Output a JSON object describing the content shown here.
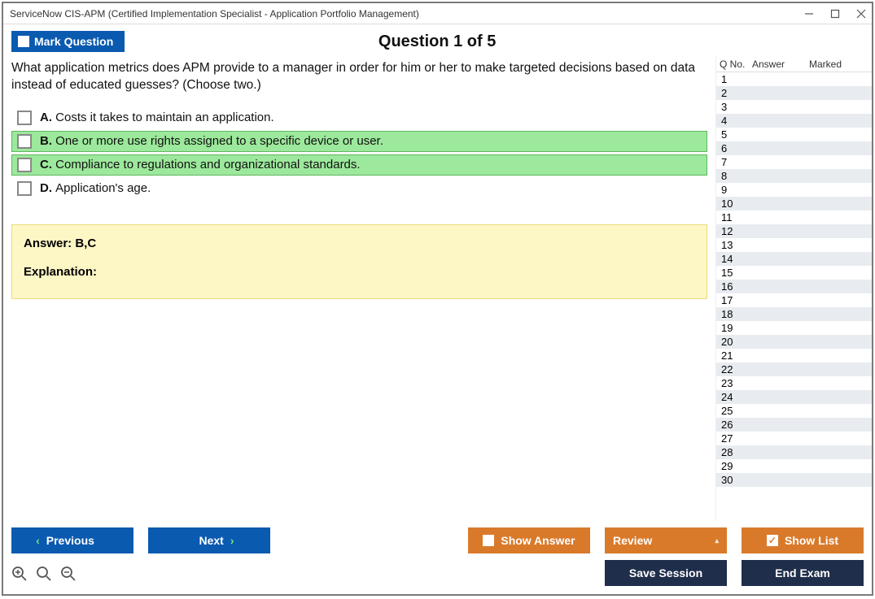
{
  "titlebar": "ServiceNow CIS-APM (Certified Implementation Specialist - Application Portfolio Management)",
  "header": {
    "mark_label": "Mark Question",
    "question_title": "Question 1 of 5"
  },
  "question": {
    "text": "What application metrics does APM provide to a manager in order for him or her to make targeted decisions based on data instead of educated guesses? (Choose two.)",
    "options": [
      {
        "letter": "A.",
        "text": "Costs it takes to maintain an application.",
        "correct": false
      },
      {
        "letter": "B.",
        "text": "One or more use rights assigned to a specific device or user.",
        "correct": true
      },
      {
        "letter": "C.",
        "text": "Compliance to regulations and organizational standards.",
        "correct": true
      },
      {
        "letter": "D.",
        "text": "Application's age.",
        "correct": false
      }
    ]
  },
  "answer_panel": {
    "answer_label": "Answer: B,C",
    "explanation_label": "Explanation:"
  },
  "side": {
    "col_qno": "Q No.",
    "col_answer": "Answer",
    "col_marked": "Marked",
    "rows": 30
  },
  "footer": {
    "previous": "Previous",
    "next": "Next",
    "show_answer": "Show Answer",
    "review": "Review",
    "show_list": "Show List",
    "save_session": "Save Session",
    "end_exam": "End Exam"
  }
}
